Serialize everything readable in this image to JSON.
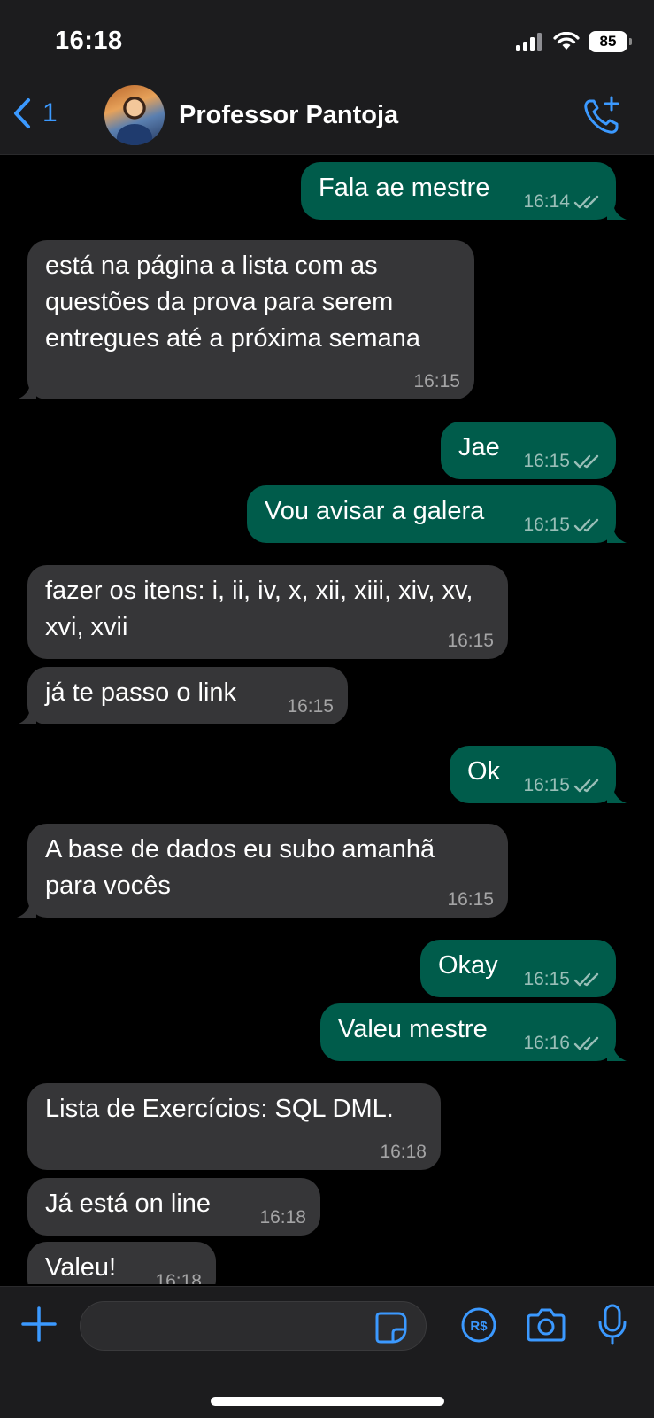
{
  "status_bar": {
    "time": "16:18",
    "battery": "85"
  },
  "header": {
    "back_count": "1",
    "contact_name": "Professor Pantoja"
  },
  "messages": [
    {
      "dir": "out",
      "text": "Fala ae mestre",
      "time": "16:14",
      "ticks": "read"
    },
    {
      "dir": "in",
      "text": "está na página a lista com as questões da prova para serem entregues até a próxima semana",
      "time": "16:15"
    },
    {
      "dir": "out",
      "text": "Jae",
      "time": "16:15",
      "ticks": "read"
    },
    {
      "dir": "out",
      "text": "Vou avisar a galera",
      "time": "16:15",
      "ticks": "read"
    },
    {
      "dir": "in",
      "text": "fazer os itens: i, ii, iv, x, xii, xiii, xiv, xv, xvi, xvii",
      "time": "16:15"
    },
    {
      "dir": "in",
      "text": "já te passo o link",
      "time": "16:15"
    },
    {
      "dir": "out",
      "text": "Ok",
      "time": "16:15",
      "ticks": "read"
    },
    {
      "dir": "in",
      "text": "A base de dados eu subo amanhã para vocês",
      "time": "16:15"
    },
    {
      "dir": "out",
      "text": "Okay",
      "time": "16:15",
      "ticks": "read"
    },
    {
      "dir": "out",
      "text": "Valeu mestre",
      "time": "16:16",
      "ticks": "read"
    },
    {
      "dir": "in",
      "text": "Lista de Exercícios: SQL DML.",
      "time": "16:18"
    },
    {
      "dir": "in",
      "text": "Já está on line",
      "time": "16:18"
    },
    {
      "dir": "in",
      "text": "Valeu!",
      "time": "16:18"
    }
  ],
  "composer": {
    "placeholder": ""
  },
  "colors": {
    "accent": "#3b99ff",
    "outgoing_bubble": "#005c4b",
    "incoming_bubble": "#363638"
  }
}
